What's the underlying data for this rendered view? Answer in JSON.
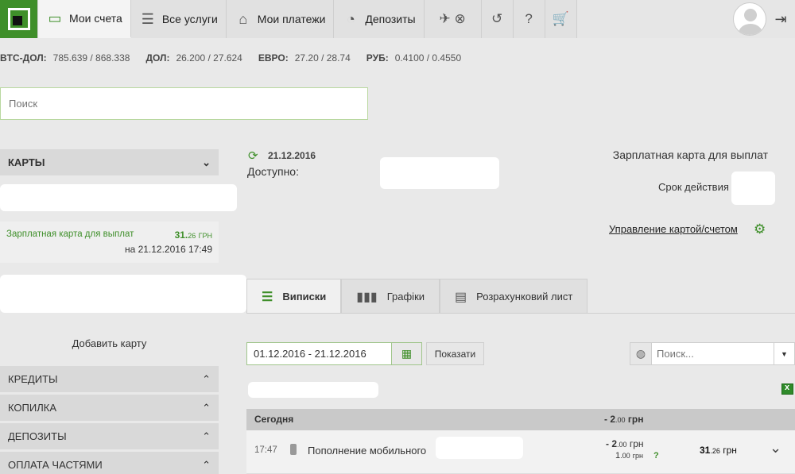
{
  "nav": {
    "accounts": "Мои счета",
    "services": "Все услуги",
    "payments": "Мои платежи",
    "deposits": "Депозиты"
  },
  "rates": [
    {
      "label": "BTC-ДОЛ:",
      "value": "785.639 / 868.338"
    },
    {
      "label": "ДОЛ:",
      "value": "26.200 / 27.624"
    },
    {
      "label": "ЕВРО:",
      "value": "27.20 / 28.74"
    },
    {
      "label": "РУБ:",
      "value": "0.4100 / 0.4550"
    }
  ],
  "search": {
    "placeholder": "Поиск"
  },
  "sidebar": {
    "cards_header": "КАРТЫ",
    "card": {
      "name": "Зарплатная карта для выплат",
      "amount_main": "31.",
      "amount_fraction": "26",
      "currency": "ГРН",
      "date": "на 21.12.2016 17:49"
    },
    "add_card": "Добавить карту",
    "sections": [
      "КРЕДИТЫ",
      "КОПИЛКА",
      "ДЕПОЗИТЫ",
      "ОПЛАТА ЧАСТЯМИ"
    ]
  },
  "main": {
    "date": "21.12.2016",
    "available": "Доступно:",
    "card_title": "Зарплатная карта для выплат",
    "expiry_label": "Срок действия",
    "manage": "Управление картой/счетом",
    "tabs": [
      "Виписки",
      "Графіки",
      "Розрахунковий лист"
    ],
    "date_range": "01.12.2016 - 21.12.2016",
    "show": "Показати",
    "search_placeholder": "Поиск...",
    "day": {
      "label": "Сегодня",
      "sum_main": "- 2",
      "sum_fraction": ".00",
      "sum_currency": "грн"
    },
    "transaction": {
      "time": "17:47",
      "description": "Пополнение мобильного",
      "amount_main": "- 2",
      "amount_fraction": ".00",
      "amount_currency": "грн",
      "secondary_main": "1",
      "secondary_fraction": ".00",
      "secondary_currency": "грн",
      "secondary_hint": "?",
      "balance_main": "31",
      "balance_fraction": ".26",
      "balance_currency": "грн"
    }
  },
  "colors": {
    "accent": "#3f8f2a",
    "background": "#e9e9e9"
  }
}
